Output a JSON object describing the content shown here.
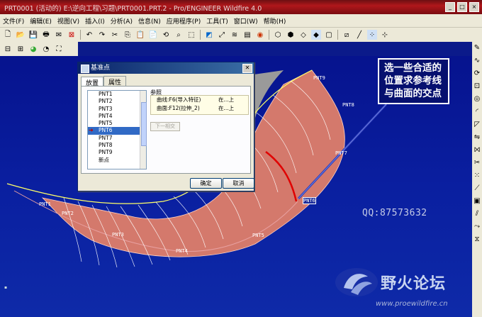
{
  "window": {
    "title": "PRT0001 (活动的) E:\\逆向工程\\习题\\PRT0001.PRT.2 - Pro/ENGINEER Wildfire 4.0",
    "buttons": [
      "_",
      "□",
      "×"
    ]
  },
  "menu": [
    "文件(F)",
    "编辑(E)",
    "视图(V)",
    "插入(I)",
    "分析(A)",
    "信息(N)",
    "应用程序(P)",
    "工具(T)",
    "窗口(W)",
    "帮助(H)"
  ],
  "dialog": {
    "title": "基准点",
    "tabs": [
      "放置",
      "属性"
    ],
    "points": [
      "PNT1",
      "PNT2",
      "PNT3",
      "PNT4",
      "PNT5",
      "PNT6",
      "PNT7",
      "PNT8",
      "PNT9",
      "新点"
    ],
    "selected": "PNT6",
    "refs_label": "参照",
    "refs": [
      {
        "item": "曲线:F6(导入特征)",
        "type": "在...上"
      },
      {
        "item": "曲面:F12(拉伸_2)",
        "type": "在...上"
      }
    ],
    "next_ref": "下一相交",
    "ok": "确定",
    "cancel": "取消"
  },
  "model_labels": {
    "pnt9": "PNT9",
    "pnt8": "PNT8",
    "pnt7": "PNT7",
    "pnt6": "PNT6",
    "pnt1": "PNT1",
    "pnt2": "PNT2",
    "pnt3": "PNT3",
    "pnt4": "PNT4",
    "pnt5": "PNT5"
  },
  "callout": [
    "选一些合适的",
    "位置求参考线",
    "与曲面的交点"
  ],
  "watermark": {
    "qq": "QQ:87573632",
    "logo": "野火论坛",
    "url": "www.proewildfire.cn"
  },
  "colors": {
    "surface": "#d97b6d",
    "highlight": "#e00000",
    "viewport": "#0a1fa0"
  }
}
